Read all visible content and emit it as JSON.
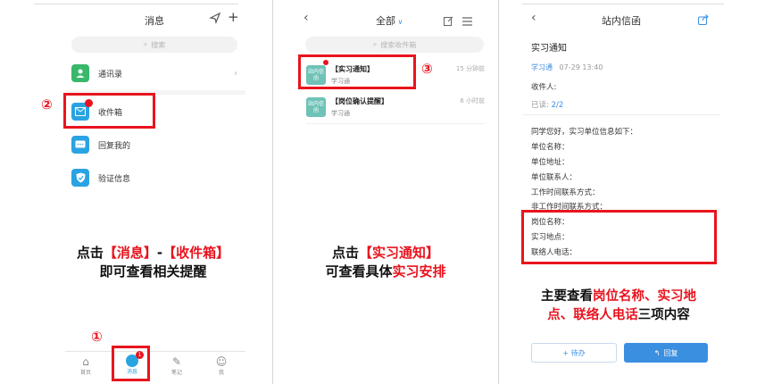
{
  "colors": {
    "accent_red": "#e8141e",
    "link_blue": "#3a8ee6",
    "primary_btn": "#3b8fe0",
    "tile_teal": "#6ec2b6"
  },
  "panel1": {
    "header_title": "消息",
    "send_icon": "paper-plane-icon",
    "add_icon": "plus-icon",
    "search_placeholder": "搜索",
    "items": [
      {
        "label": "通讯录",
        "icon": "contacts-icon",
        "color": "#39b86b"
      },
      {
        "label": "收件箱",
        "icon": "mail-icon",
        "color": "#2aa3e2",
        "badge": ""
      },
      {
        "label": "回复我的",
        "icon": "chat-icon",
        "color": "#2aa3e2"
      },
      {
        "label": "验证信息",
        "icon": "shield-icon",
        "color": "#2aa3e2"
      }
    ],
    "step_inbox": "②",
    "step_tab": "①",
    "caption_l1": [
      "点击",
      "【消息】",
      "-",
      "【收件箱】"
    ],
    "caption_l2": "即可查看相关提醒",
    "tabs": [
      {
        "label": "首页",
        "icon": "home-icon"
      },
      {
        "label": "消息",
        "icon": "message-icon",
        "badge": "1"
      },
      {
        "label": "笔记",
        "icon": "note-icon"
      },
      {
        "label": "我",
        "icon": "person-icon"
      }
    ]
  },
  "panel2": {
    "filter_label": "全部",
    "search_placeholder": "搜索收件箱",
    "messages": [
      {
        "tile": "站内信函",
        "title": "【实习通知】",
        "sub": "学习通",
        "time": "15 分钟前"
      },
      {
        "tile": "站内信函",
        "title": "【岗位确认提醒】",
        "sub": "学习通",
        "time": "6 小时前"
      }
    ],
    "step": "③",
    "caption_l1": [
      "点击",
      "【实习通知】"
    ],
    "caption_l2": [
      "可查看具体",
      "实习安排"
    ]
  },
  "panel3": {
    "header_title": "站内信函",
    "subject": "实习通知",
    "sender": "学习通",
    "date": "07-29 13:40",
    "recipient_label": "收件人:",
    "read_label": "已读:",
    "read_value": "2/2",
    "body_lines": [
      "同学您好，实习单位信息如下：",
      "单位名称：",
      "单位地址：",
      "单位联系人：",
      "工作时间联系方式：",
      "非工作时间联系方式："
    ],
    "highlight_lines": [
      "岗位名称：",
      "实习地点：",
      "联络人电话："
    ],
    "caption_l1": [
      "主要查看",
      "岗位名称、实习地"
    ],
    "caption_l2": [
      "点、联络人电话",
      "三项内容"
    ],
    "btn_todo": "+ 待办",
    "btn_reply": "回复"
  }
}
